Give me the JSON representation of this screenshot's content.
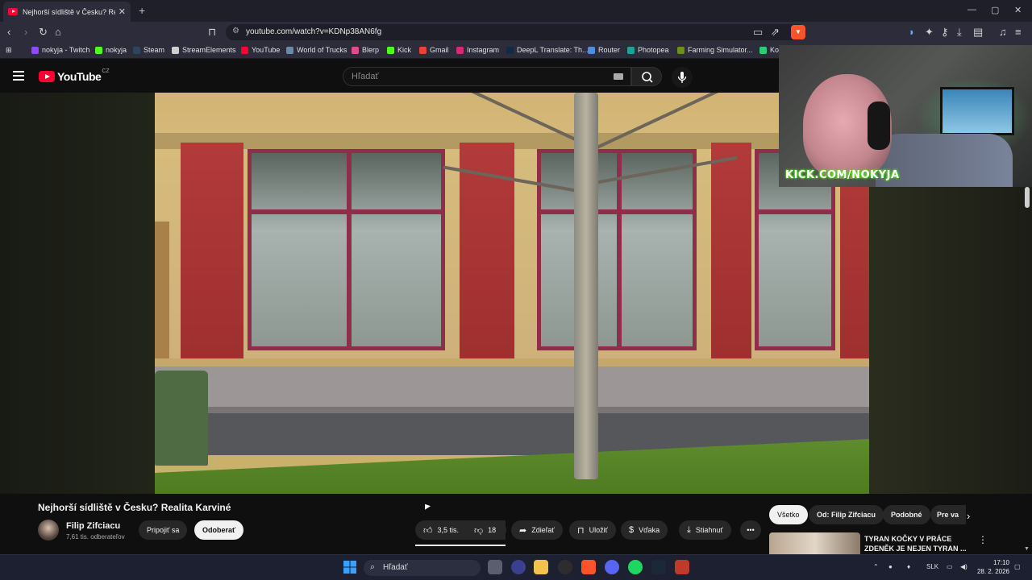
{
  "browser": {
    "tab_title": "Nejhorší sídliště v Česku? Rea",
    "url": "youtube.com/watch?v=KDNp38AN6fg"
  },
  "bookmarks": [
    {
      "label": "nokyja - Twitch",
      "color": "#9146ff"
    },
    {
      "label": "nokyja",
      "color": "#53fc18"
    },
    {
      "label": "Steam",
      "color": "#1b2838"
    },
    {
      "label": "StreamElements",
      "color": "#ffffff"
    },
    {
      "label": "YouTube",
      "color": "#ff0033"
    },
    {
      "label": "World of Trucks",
      "color": "#6c8aa8"
    },
    {
      "label": "Blerp",
      "color": "#e54b8a"
    },
    {
      "label": "Kick",
      "color": "#53fc18"
    },
    {
      "label": "Gmail",
      "color": "#ea4335"
    },
    {
      "label": "Instagram",
      "color": "#d62976"
    },
    {
      "label": "DeepL Translate: Th...",
      "color": "#0f2b46"
    },
    {
      "label": "Router",
      "color": "#4a90e2"
    },
    {
      "label": "Photopea",
      "color": "#18a497"
    },
    {
      "label": "Farming Simulator...",
      "color": "#6b8e23"
    },
    {
      "label": "Ko",
      "color": "#2ecc71"
    }
  ],
  "youtube": {
    "logo_text": "YouTube",
    "country": "CZ",
    "search_placeholder": "Hľadať"
  },
  "webcam": {
    "overlay_text": "KICK.COM/NOKYJA"
  },
  "video": {
    "title": "Nejhorší sídliště v Česku? Realita Karviné",
    "channel": "Filip Zifciacu",
    "subscribers": "7,61 tis. odberateľov",
    "join_label": "Pripojiť sa",
    "subscribe_label": "Odoberať",
    "likes": "3,5 tis.",
    "dislikes": "18",
    "share_label": "Zdieľať",
    "save_label": "Uložiť",
    "thanks_label": "Vďaka",
    "download_label": "Stiahnuť"
  },
  "chips": [
    "Všetko",
    "Od: Filip Zifciacu",
    "Podobné",
    "Pre va"
  ],
  "recommendation": {
    "title": "TYRAN KOČKY V PRÁCE ZDENĚK JE NEJEN TYRAN ..."
  },
  "taskbar": {
    "search_placeholder": "Hľadať",
    "language": "SLK",
    "time": "17:10",
    "date": "28. 2. 2026"
  },
  "colors": {
    "youtube_red": "#ff0033",
    "kick_green": "#53fc18",
    "page_bg": "#0f0f0f"
  }
}
